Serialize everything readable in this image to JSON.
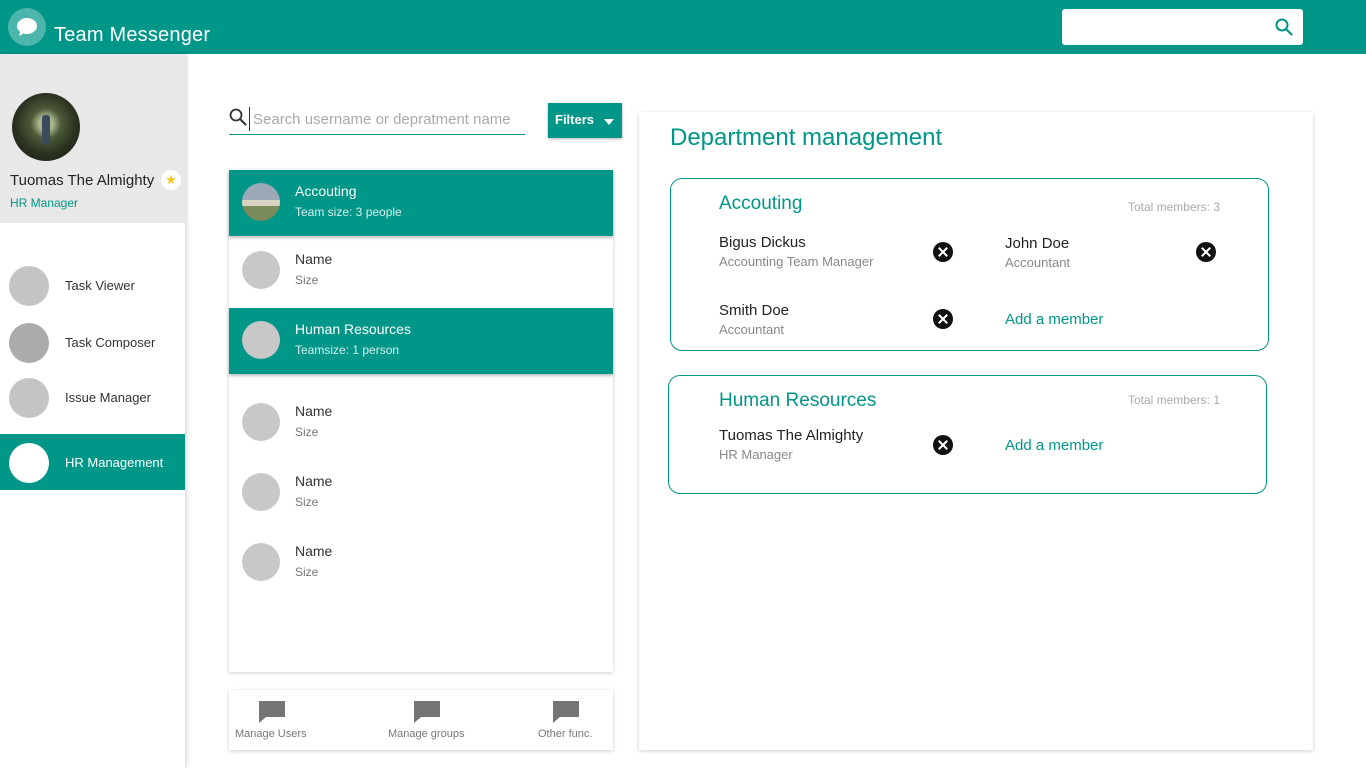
{
  "colors": {
    "primary": "#009688",
    "sidebar_profile_bg": "#e8e8e8",
    "star": "#f5c518"
  },
  "header": {
    "app_title": "Team Messenger",
    "logo_icon": "chat-bubble-icon",
    "search_icon": "search-icon"
  },
  "profile": {
    "name": "Tuomas The Almighty",
    "role": "HR Manager",
    "badge_icon": "star-icon"
  },
  "sidebar": {
    "items": [
      {
        "label": "Task Viewer",
        "active": false
      },
      {
        "label": "Task Composer",
        "active": false
      },
      {
        "label": "Issue Manager",
        "active": false
      },
      {
        "label": "HR Management",
        "active": true
      }
    ]
  },
  "search": {
    "placeholder": "Search username or depratment name",
    "value": ""
  },
  "filters": {
    "label": "Filters"
  },
  "departments": [
    {
      "title": "Accouting",
      "sub": "Team size: 3 people",
      "selected": true
    },
    {
      "title": "Name",
      "sub": "Size",
      "selected": false
    },
    {
      "title": "Human Resources",
      "sub": "Teamsize: 1 person",
      "selected": true
    },
    {
      "title": "Name",
      "sub": "Size",
      "selected": false
    },
    {
      "title": "Name",
      "sub": "Size",
      "selected": false
    },
    {
      "title": "Name",
      "sub": "Size",
      "selected": false
    }
  ],
  "bottom_nav": [
    {
      "label": "Manage Users",
      "icon": "message-icon"
    },
    {
      "label": "Manage groups",
      "icon": "message-icon"
    },
    {
      "label": "Other func.",
      "icon": "message-icon"
    }
  ],
  "management": {
    "title": "Department management",
    "cards": [
      {
        "name": "Accouting",
        "total": "Total members: 3",
        "members": [
          {
            "name": "Bigus Dickus",
            "role": "Accounting Team Manager"
          },
          {
            "name": "John Doe",
            "role": "Accountant"
          },
          {
            "name": "Smith Doe",
            "role": "Accountant"
          }
        ],
        "add_label": "Add a member"
      },
      {
        "name": "Human Resources",
        "total": "Total members: 1",
        "members": [
          {
            "name": "Tuomas The Almighty",
            "role": "HR Manager"
          }
        ],
        "add_label": "Add a member"
      }
    ]
  }
}
